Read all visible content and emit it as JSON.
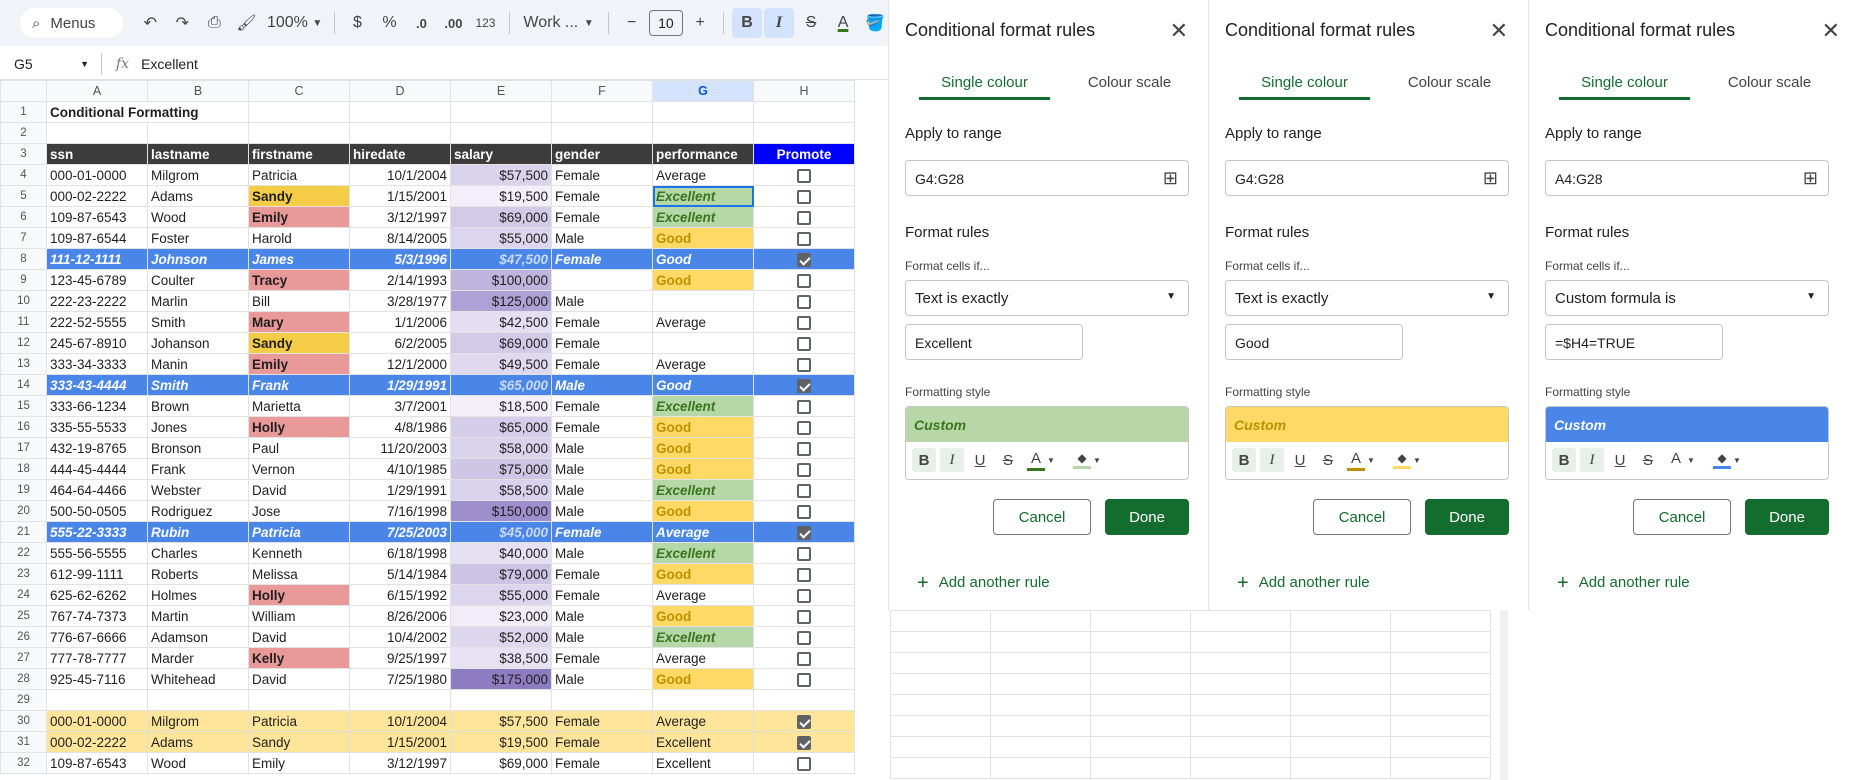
{
  "toolbar": {
    "search_label": "Menus",
    "zoom": "100%",
    "currency": "$",
    "percent": "%",
    "dec_decrease": ".0",
    "dec_increase": ".00",
    "number_format": "123",
    "font": "Work ...",
    "font_size": "10"
  },
  "formula_bar": {
    "name_box": "G5",
    "value": "Excellent"
  },
  "columns": [
    "A",
    "B",
    "C",
    "D",
    "E",
    "F",
    "G",
    "H"
  ],
  "selected_column": "G",
  "title": "Conditional Formatting",
  "headers": [
    "ssn",
    "lastname",
    "firstname",
    "hiredate",
    "salary",
    "gender",
    "performance",
    "Promote"
  ],
  "rows": [
    {
      "n": "4",
      "ssn": "000-01-0000",
      "last": "Milgrom",
      "first": "Patricia",
      "hire": "10/1/2004",
      "salary": "$57,500",
      "gender": "Female",
      "perf": "Average",
      "promote": false
    },
    {
      "n": "5",
      "ssn": "000-02-2222",
      "last": "Adams",
      "first": "Sandy",
      "hire": "1/15/2001",
      "salary": "$19,500",
      "gender": "Female",
      "perf": "Excellent",
      "promote": false
    },
    {
      "n": "6",
      "ssn": "109-87-6543",
      "last": "Wood",
      "first": "Emily",
      "hire": "3/12/1997",
      "salary": "$69,000",
      "gender": "Female",
      "perf": "Excellent",
      "promote": false
    },
    {
      "n": "7",
      "ssn": "109-87-6544",
      "last": "Foster",
      "first": "Harold",
      "hire": "8/14/2005",
      "salary": "$55,000",
      "gender": "Male",
      "perf": "Good",
      "promote": false
    },
    {
      "n": "8",
      "ssn": "111-12-1111",
      "last": "Johnson",
      "first": "James",
      "hire": "5/3/1996",
      "salary": "$47,500",
      "gender": "Female",
      "perf": "Good",
      "promote": true
    },
    {
      "n": "9",
      "ssn": "123-45-6789",
      "last": "Coulter",
      "first": "Tracy",
      "hire": "2/14/1993",
      "salary": "$100,000",
      "gender": "",
      "perf": "Good",
      "promote": false
    },
    {
      "n": "10",
      "ssn": "222-23-2222",
      "last": "Marlin",
      "first": "Bill",
      "hire": "3/28/1977",
      "salary": "$125,000",
      "gender": "Male",
      "perf": "",
      "promote": false
    },
    {
      "n": "11",
      "ssn": "222-52-5555",
      "last": "Smith",
      "first": "Mary",
      "hire": "1/1/2006",
      "salary": "$42,500",
      "gender": "Female",
      "perf": "Average",
      "promote": false
    },
    {
      "n": "12",
      "ssn": "245-67-8910",
      "last": "Johanson",
      "first": "Sandy",
      "hire": "6/2/2005",
      "salary": "$69,000",
      "gender": "Female",
      "perf": "",
      "promote": false
    },
    {
      "n": "13",
      "ssn": "333-34-3333",
      "last": "Manin",
      "first": "Emily",
      "hire": "12/1/2000",
      "salary": "$49,500",
      "gender": "Female",
      "perf": "Average",
      "promote": false
    },
    {
      "n": "14",
      "ssn": "333-43-4444",
      "last": "Smith",
      "first": "Frank",
      "hire": "1/29/1991",
      "salary": "$65,000",
      "gender": "Male",
      "perf": "Good",
      "promote": true
    },
    {
      "n": "15",
      "ssn": "333-66-1234",
      "last": "Brown",
      "first": "Marietta",
      "hire": "3/7/2001",
      "salary": "$18,500",
      "gender": "Female",
      "perf": "Excellent",
      "promote": false
    },
    {
      "n": "16",
      "ssn": "335-55-5533",
      "last": "Jones",
      "first": "Holly",
      "hire": "4/8/1986",
      "salary": "$65,000",
      "gender": "Female",
      "perf": "Good",
      "promote": false
    },
    {
      "n": "17",
      "ssn": "432-19-8765",
      "last": "Bronson",
      "first": "Paul",
      "hire": "11/20/2003",
      "salary": "$58,000",
      "gender": "Male",
      "perf": "Good",
      "promote": false
    },
    {
      "n": "18",
      "ssn": "444-45-4444",
      "last": "Frank",
      "first": "Vernon",
      "hire": "4/10/1985",
      "salary": "$75,000",
      "gender": "Male",
      "perf": "Good",
      "promote": false
    },
    {
      "n": "19",
      "ssn": "464-64-4466",
      "last": "Webster",
      "first": "David",
      "hire": "1/29/1991",
      "salary": "$58,500",
      "gender": "Male",
      "perf": "Excellent",
      "promote": false
    },
    {
      "n": "20",
      "ssn": "500-50-0505",
      "last": "Rodriguez",
      "first": "Jose",
      "hire": "7/16/1998",
      "salary": "$150,000",
      "gender": "Male",
      "perf": "Good",
      "promote": false
    },
    {
      "n": "21",
      "ssn": "555-22-3333",
      "last": "Rubin",
      "first": "Patricia",
      "hire": "7/25/2003",
      "salary": "$45,000",
      "gender": "Female",
      "perf": "Average",
      "promote": true
    },
    {
      "n": "22",
      "ssn": "555-56-5555",
      "last": "Charles",
      "first": "Kenneth",
      "hire": "6/18/1998",
      "salary": "$40,000",
      "gender": "Male",
      "perf": "Excellent",
      "promote": false
    },
    {
      "n": "23",
      "ssn": "612-99-1111",
      "last": "Roberts",
      "first": "Melissa",
      "hire": "5/14/1984",
      "salary": "$79,000",
      "gender": "Female",
      "perf": "Good",
      "promote": false
    },
    {
      "n": "24",
      "ssn": "625-62-6262",
      "last": "Holmes",
      "first": "Holly",
      "hire": "6/15/1992",
      "salary": "$55,000",
      "gender": "Female",
      "perf": "Average",
      "promote": false
    },
    {
      "n": "25",
      "ssn": "767-74-7373",
      "last": "Martin",
      "first": "William",
      "hire": "8/26/2006",
      "salary": "$23,000",
      "gender": "Male",
      "perf": "Good",
      "promote": false
    },
    {
      "n": "26",
      "ssn": "776-67-6666",
      "last": "Adamson",
      "first": "David",
      "hire": "10/4/2002",
      "salary": "$52,000",
      "gender": "Male",
      "perf": "Excellent",
      "promote": false
    },
    {
      "n": "27",
      "ssn": "777-78-7777",
      "last": "Marder",
      "first": "Kelly",
      "hire": "9/25/1997",
      "salary": "$38,500",
      "gender": "Female",
      "perf": "Average",
      "promote": false
    },
    {
      "n": "28",
      "ssn": "925-45-7116",
      "last": "Whitehead",
      "first": "David",
      "hire": "7/25/1980",
      "salary": "$175,000",
      "gender": "Male",
      "perf": "Good",
      "promote": false
    }
  ],
  "extra_rows": [
    {
      "n": "30",
      "ssn": "000-01-0000",
      "last": "Milgrom",
      "first": "Patricia",
      "hire": "10/1/2004",
      "salary": "$57,500",
      "gender": "Female",
      "perf": "Average",
      "promote": true
    },
    {
      "n": "31",
      "ssn": "000-02-2222",
      "last": "Adams",
      "first": "Sandy",
      "hire": "1/15/2001",
      "salary": "$19,500",
      "gender": "Female",
      "perf": "Excellent",
      "promote": true
    },
    {
      "n": "32",
      "ssn": "109-87-6543",
      "last": "Wood",
      "first": "Emily",
      "hire": "3/12/1997",
      "salary": "$69,000",
      "gender": "Female",
      "perf": "Excellent",
      "promote": false
    }
  ],
  "panels": [
    {
      "title": "Conditional format rules",
      "tab_single": "Single colour",
      "tab_scale": "Colour scale",
      "apply_label": "Apply to range",
      "range": "G4:G28",
      "rules_label": "Format rules",
      "cells_if_label": "Format cells if...",
      "condition": "Text is exactly",
      "value": "Excellent",
      "style_label": "Formatting style",
      "preview": "Custom",
      "preview_bg": "#b7d7a8",
      "preview_fg": "#38761d",
      "text_bar": "#38761d",
      "fill_bar": "#b7d7a8",
      "cancel": "Cancel",
      "done": "Done",
      "add_rule": "Add another rule"
    },
    {
      "title": "Conditional format rules",
      "tab_single": "Single colour",
      "tab_scale": "Colour scale",
      "apply_label": "Apply to range",
      "range": "G4:G28",
      "rules_label": "Format rules",
      "cells_if_label": "Format cells if...",
      "condition": "Text is exactly",
      "value": "Good",
      "style_label": "Formatting style",
      "preview": "Custom",
      "preview_bg": "#ffd966",
      "preview_fg": "#bf9000",
      "text_bar": "#bf9000",
      "fill_bar": "#ffd966",
      "cancel": "Cancel",
      "done": "Done",
      "add_rule": "Add another rule"
    },
    {
      "title": "Conditional format rules",
      "tab_single": "Single colour",
      "tab_scale": "Colour scale",
      "apply_label": "Apply to range",
      "range": "A4:G28",
      "rules_label": "Format rules",
      "cells_if_label": "Format cells if...",
      "condition": "Custom formula is",
      "value": "=$H4=TRUE",
      "style_label": "Formatting style",
      "preview": "Custom",
      "preview_bg": "#4a86e8",
      "preview_fg": "#ffffff",
      "text_bar": "#ffffff",
      "fill_bar": "#4a86e8",
      "cancel": "Cancel",
      "done": "Done",
      "add_rule": "Add another rule"
    }
  ]
}
